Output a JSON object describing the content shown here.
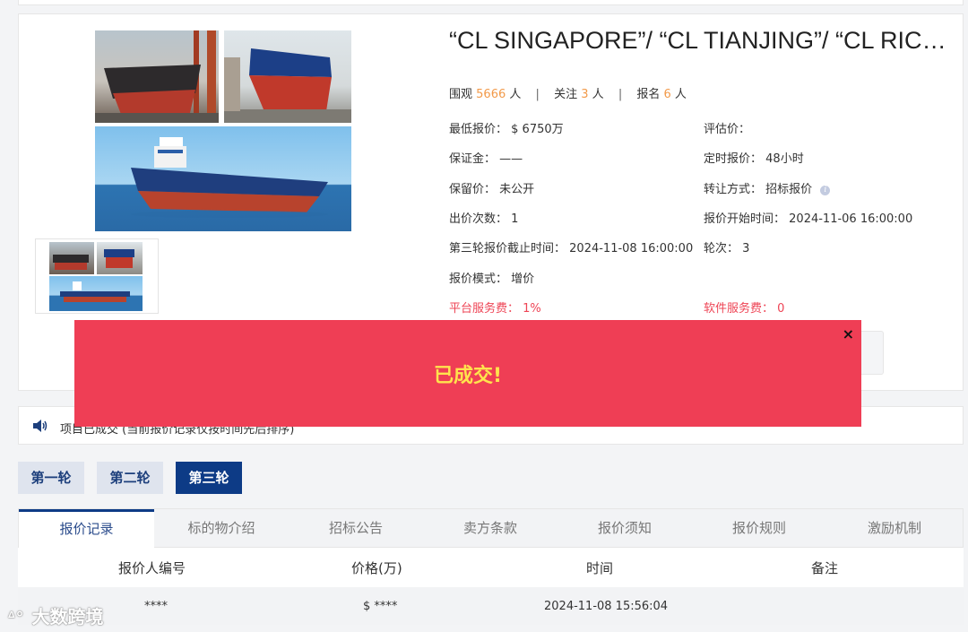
{
  "listing": {
    "title": "“CL SINGAPORE”/ “CL TIANJING”/ “CL RICHMOND”",
    "stats": {
      "views_label": "围观",
      "views": "5666",
      "views_unit": "人",
      "follows_label": "关注",
      "follows": "3",
      "follows_unit": "人",
      "signups_label": "报名",
      "signups": "6",
      "signups_unit": "人",
      "separator": "|"
    },
    "info": {
      "min_price_label": "最低报价：",
      "min_price_value": "$ 6750万",
      "appraisal_label": "评估价：",
      "appraisal_value": "",
      "deposit_label": "保证金：",
      "deposit_value": "——",
      "timed_quote_label": "定时报价：",
      "timed_quote_value": "48小时",
      "reserve_label": "保留价：",
      "reserve_value": "未公开",
      "transfer_label": "转让方式：",
      "transfer_value": "招标报价",
      "bid_count_label": "出价次数：",
      "bid_count_value": "1",
      "start_time_label": "报价开始时间：",
      "start_time_value": "2024-11-06 16:00:00",
      "round3_deadline_label": "第三轮报价截止时间：",
      "round3_deadline_value": "2024-11-08 16:00:00",
      "round_label": "轮次：",
      "round_value": "3",
      "mode_label": "报价模式：",
      "mode_value": "增价",
      "platform_fee_label": "平台服务费：",
      "platform_fee_value": "1%",
      "software_fee_label": "软件服务费：",
      "software_fee_value": "0"
    }
  },
  "notice": {
    "text": "项目已成交 (当前报价记录仅按时间先后排序)"
  },
  "rounds": [
    "第一轮",
    "第二轮",
    "第三轮"
  ],
  "tabs": [
    "报价记录",
    "标的物介绍",
    "招标公告",
    "卖方条款",
    "报价须知",
    "报价规则",
    "激励机制"
  ],
  "table": {
    "headers": [
      "报价人编号",
      "价格(万)",
      "时间",
      "备注"
    ],
    "rows": [
      {
        "bidder": "****",
        "price": "$ ****",
        "time": "2024-11-08 15:56:04",
        "note": ""
      }
    ]
  },
  "modal": {
    "close": "×",
    "message": "已成交!"
  },
  "watermark": {
    "text": "大数跨境"
  },
  "colors": {
    "accent_navy": "#0d3b86",
    "modal_red": "#ef3e55",
    "modal_text_yellow": "#ffe34d",
    "stat_orange": "#f29a4a",
    "fee_red": "#ee4455"
  }
}
